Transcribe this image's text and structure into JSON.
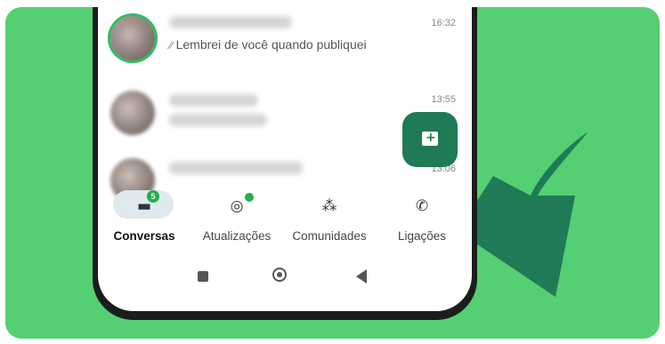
{
  "colors": {
    "background_green": "#54cf72",
    "arrow_green": "#1f7a56",
    "accent_green": "#20b04c"
  },
  "chats": [
    {
      "preview": "Lembrei de você quando publiquei",
      "time": "16:32"
    },
    {
      "preview": "",
      "time": "13:55"
    },
    {
      "preview": "",
      "time": "13:06"
    }
  ],
  "fab": {
    "icon": "new-chat-icon"
  },
  "nav": {
    "items": [
      {
        "label": "Conversas",
        "icon": "chats-icon",
        "badge": "5",
        "active": true
      },
      {
        "label": "Atualizações",
        "icon": "status-icon"
      },
      {
        "label": "Comunidades",
        "icon": "communities-icon"
      },
      {
        "label": "Ligações",
        "icon": "calls-icon"
      }
    ]
  },
  "system_bar": {
    "icons": [
      "recents-icon",
      "home-icon",
      "back-icon"
    ]
  }
}
